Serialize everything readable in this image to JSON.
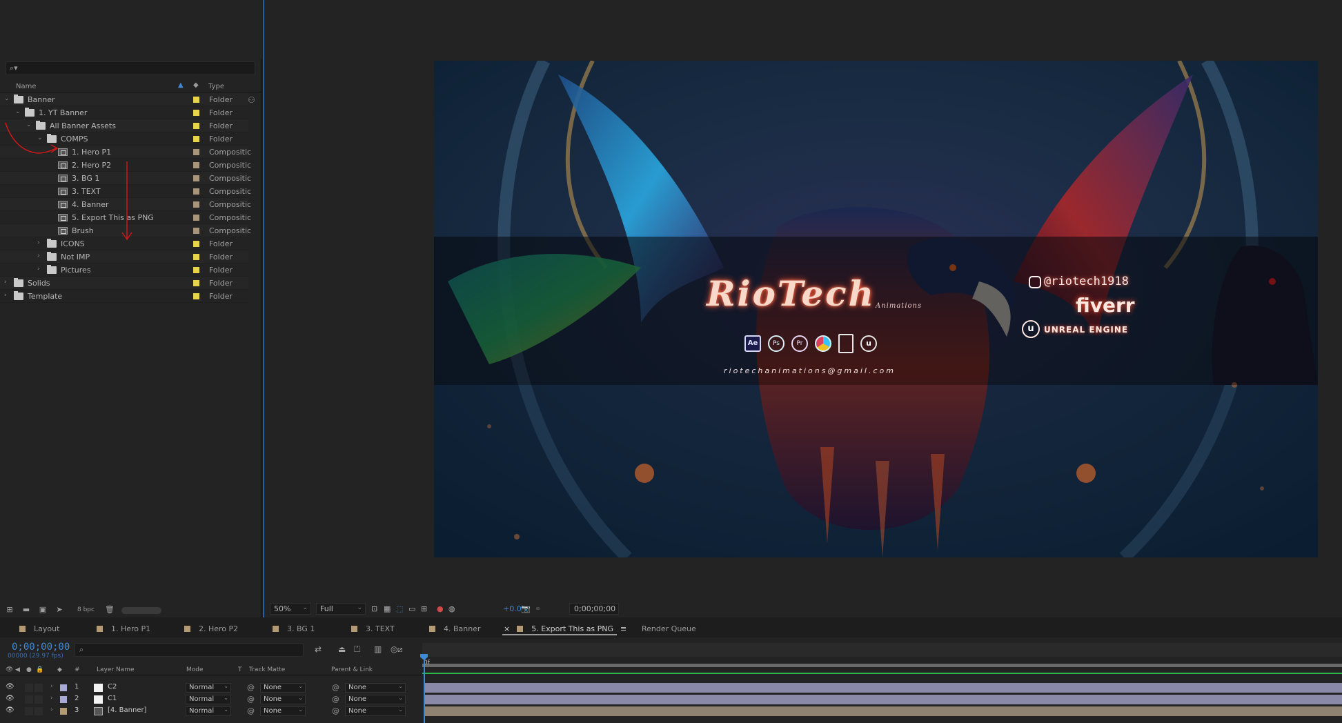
{
  "project": {
    "search_placeholder": "",
    "columns": {
      "name": "Name",
      "type": "Type"
    },
    "items": [
      {
        "label": "Banner",
        "kind": "folder",
        "indent": 0,
        "open": true,
        "type": "Folder",
        "tag": "#e8d44a"
      },
      {
        "label": "1. YT Banner",
        "kind": "folder",
        "indent": 1,
        "open": true,
        "type": "Folder",
        "tag": "#e8d44a"
      },
      {
        "label": "All Banner Assets",
        "kind": "folder",
        "indent": 2,
        "open": true,
        "type": "Folder",
        "tag": "#e8d44a"
      },
      {
        "label": "COMPS",
        "kind": "folder",
        "indent": 3,
        "open": true,
        "type": "Folder",
        "tag": "#e8d44a"
      },
      {
        "label": "1. Hero P1",
        "kind": "comp",
        "indent": 4,
        "type": "Compositic",
        "tag": "#a8957a"
      },
      {
        "label": "2. Hero P2",
        "kind": "comp",
        "indent": 4,
        "type": "Compositic",
        "tag": "#a8957a"
      },
      {
        "label": "3. BG 1",
        "kind": "comp",
        "indent": 4,
        "type": "Compositic",
        "tag": "#a8957a"
      },
      {
        "label": "3. TEXT",
        "kind": "comp",
        "indent": 4,
        "type": "Compositic",
        "tag": "#a8957a"
      },
      {
        "label": "4. Banner",
        "kind": "comp",
        "indent": 4,
        "type": "Compositic",
        "tag": "#a8957a"
      },
      {
        "label": "5. Export This as PNG",
        "kind": "comp",
        "indent": 4,
        "type": "Compositic",
        "tag": "#a8957a"
      },
      {
        "label": "Brush",
        "kind": "comp",
        "indent": 4,
        "type": "Compositic",
        "tag": "#a8957a"
      },
      {
        "label": "ICONS",
        "kind": "folder",
        "indent": 3,
        "open": false,
        "type": "Folder",
        "tag": "#e8d44a"
      },
      {
        "label": "Not IMP",
        "kind": "folder",
        "indent": 3,
        "open": false,
        "type": "Folder",
        "tag": "#e8d44a"
      },
      {
        "label": "Pictures",
        "kind": "folder",
        "indent": 3,
        "open": false,
        "type": "Folder",
        "tag": "#e8d44a"
      },
      {
        "label": "Solids",
        "kind": "folder",
        "indent": 0,
        "open": false,
        "type": "Folder",
        "tag": "#e8d44a"
      },
      {
        "label": "Template",
        "kind": "folder",
        "indent": 0,
        "open": false,
        "type": "Folder",
        "tag": "#e8d44a"
      }
    ],
    "footer": {
      "bpc": "8 bpc"
    }
  },
  "viewer": {
    "zoom": "50%",
    "resolution": "Full",
    "exposure": "+0.0",
    "timecode": "0;00;00;00"
  },
  "banner": {
    "brand": "RioTech",
    "brand_sub": "Animations",
    "email": "riotechanimations@gmail.com",
    "instagram": "@riotech1918",
    "fiverr": "fiverr",
    "unreal": "UNREAL ENGINE",
    "apps": [
      "Ae",
      "Ps",
      "Pr"
    ]
  },
  "timeline": {
    "tabs": [
      {
        "label": "Layout"
      },
      {
        "label": "1. Hero P1"
      },
      {
        "label": "2. Hero P2"
      },
      {
        "label": "3. BG 1"
      },
      {
        "label": "3. TEXT"
      },
      {
        "label": "4. Banner"
      },
      {
        "label": "5. Export This as PNG",
        "active": true
      },
      {
        "label": "Render Queue"
      }
    ],
    "timecode": "0;00;00;00",
    "fps": "00000 (29.97 fps)",
    "ruler_label": "0f",
    "headers": {
      "layer_name": "Layer Name",
      "mode": "Mode",
      "t": "T",
      "track_matte": "Track Matte",
      "parent": "Parent & Link",
      "hash": "#"
    },
    "layers": [
      {
        "num": "1",
        "name": "C2",
        "mode": "Normal",
        "matte": "None",
        "parent": "None",
        "label": "#a9a9d6",
        "icon": "solid",
        "bar": "#8a8aa8"
      },
      {
        "num": "2",
        "name": "C1",
        "mode": "Normal",
        "matte": "None",
        "parent": "None",
        "label": "#a9a9d6",
        "icon": "solid",
        "bar": "#8a8aa8"
      },
      {
        "num": "3",
        "name": "[4. Banner]",
        "mode": "Normal",
        "matte": "None",
        "parent": "None",
        "label": "#b49a72",
        "icon": "comp",
        "bar": "#8f8270"
      }
    ]
  }
}
